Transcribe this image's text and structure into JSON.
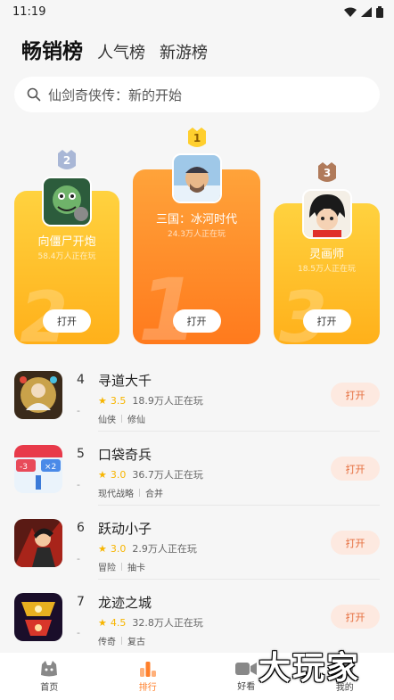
{
  "status_bar": {
    "time": "11:19"
  },
  "tabs": [
    {
      "label": "畅销榜",
      "active": true
    },
    {
      "label": "人气榜",
      "active": false
    },
    {
      "label": "新游榜",
      "active": false
    }
  ],
  "search": {
    "placeholder": "仙剑奇侠传：新的开始"
  },
  "podium": [
    {
      "rank": "2",
      "name": "向僵尸开炮",
      "players": "58.4万人正在玩",
      "button": "打开"
    },
    {
      "rank": "1",
      "name": "三国：冰河时代",
      "players": "24.3万人正在玩",
      "button": "打开"
    },
    {
      "rank": "3",
      "name": "灵画师",
      "players": "18.5万人正在玩",
      "button": "打开"
    }
  ],
  "list": [
    {
      "rank": "4",
      "name": "寻道大千",
      "rating": "3.5",
      "players": "18.9万人正在玩",
      "tags": [
        "仙侠",
        "修仙"
      ],
      "button": "打开"
    },
    {
      "rank": "5",
      "name": "口袋奇兵",
      "rating": "3.0",
      "players": "36.7万人正在玩",
      "tags": [
        "现代战略",
        "合并"
      ],
      "button": "打开"
    },
    {
      "rank": "6",
      "name": "跃动小子",
      "rating": "3.0",
      "players": "2.9万人正在玩",
      "tags": [
        "冒险",
        "抽卡"
      ],
      "button": "打开"
    },
    {
      "rank": "7",
      "name": "龙迹之城",
      "rating": "4.5",
      "players": "32.8万人正在玩",
      "tags": [
        "传奇",
        "复古"
      ],
      "button": "打开"
    }
  ],
  "bottom_nav": [
    {
      "label": "首页",
      "icon": "home-icon",
      "active": false
    },
    {
      "label": "排行",
      "icon": "ranking-icon",
      "active": true
    },
    {
      "label": "好看",
      "icon": "video-icon",
      "active": false
    },
    {
      "label": "我的",
      "icon": "profile-icon",
      "active": false
    }
  ],
  "watermark": "大玩家",
  "colors": {
    "accent": "#ff7f2a",
    "gold": "#ffc21f",
    "orange": "#ff8a2a",
    "button_bg": "#fde9e0",
    "button_text": "#e56b3a",
    "star": "#f7b500"
  }
}
